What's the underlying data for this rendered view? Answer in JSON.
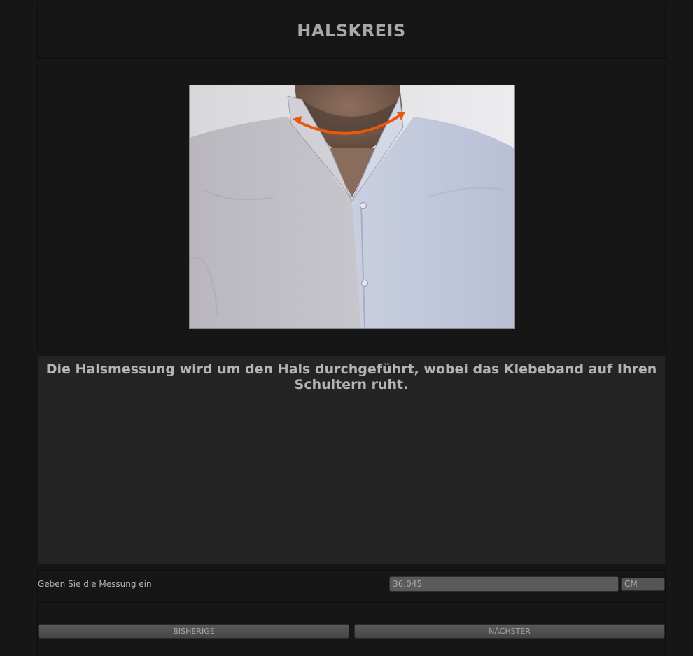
{
  "title": "HALSKREIS",
  "description": "Die Halsmessung wird um den Hals durchgeführt, wobei das Klebeband auf Ihren Schultern ruht.",
  "measurement": {
    "label": "Geben Sie die Messung ein",
    "value": "36.045",
    "unit": "CM"
  },
  "navigation": {
    "previous_label": "BISHERIGE",
    "next_label": "NÄCHSTER"
  },
  "colors": {
    "background": "#161616",
    "panel_dark": "#242424",
    "arrow": "#e8590c"
  }
}
